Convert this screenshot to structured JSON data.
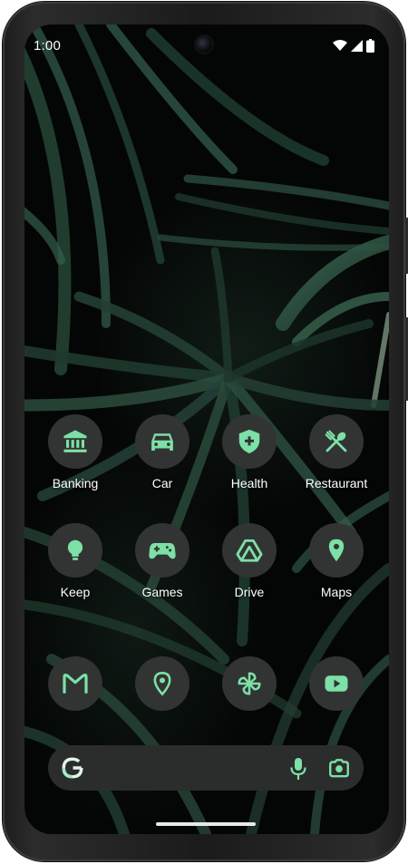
{
  "status_bar": {
    "time": "1:00",
    "icons": [
      "wifi-icon",
      "cellular-signal-icon",
      "battery-icon"
    ]
  },
  "theme": {
    "icon_background": "#323433",
    "icon_accent": "#7de0a6",
    "label_color": "#ffffff",
    "wallpaper": "dark palm fronds"
  },
  "home": {
    "row1": [
      {
        "label": "Banking",
        "icon": "bank-icon"
      },
      {
        "label": "Car",
        "icon": "car-icon"
      },
      {
        "label": "Health",
        "icon": "health-shield-icon"
      },
      {
        "label": "Restaurant",
        "icon": "fork-spoon-icon"
      }
    ],
    "row2": [
      {
        "label": "Keep",
        "icon": "lightbulb-icon"
      },
      {
        "label": "Games",
        "icon": "gamepad-icon"
      },
      {
        "label": "Drive",
        "icon": "drive-icon"
      },
      {
        "label": "Maps",
        "icon": "map-pin-icon"
      }
    ]
  },
  "dock": [
    {
      "app": "Gmail",
      "icon": "gmail-icon"
    },
    {
      "app": "Maps",
      "icon": "map-pin-outline-icon"
    },
    {
      "app": "Photos",
      "icon": "pinwheel-icon"
    },
    {
      "app": "YouTube",
      "icon": "youtube-icon"
    }
  ],
  "search": {
    "icons": [
      "google-g-icon",
      "microphone-icon",
      "lens-camera-icon"
    ]
  }
}
